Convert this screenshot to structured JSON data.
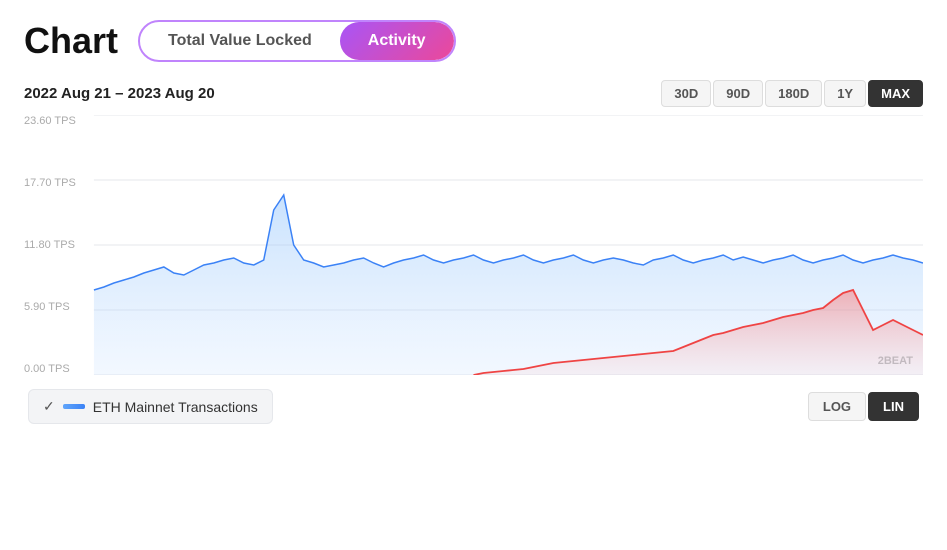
{
  "header": {
    "title": "Chart",
    "toggle": {
      "option1": "Total Value Locked",
      "option2": "Activity",
      "active": "Activity"
    }
  },
  "dateRange": {
    "label": "2022 Aug 21 – 2023 Aug 20"
  },
  "periodButtons": [
    {
      "label": "30D",
      "active": false
    },
    {
      "label": "90D",
      "active": false
    },
    {
      "label": "180D",
      "active": false
    },
    {
      "label": "1Y",
      "active": false
    },
    {
      "label": "MAX",
      "active": true
    }
  ],
  "yLabels": [
    {
      "value": "23.60 TPS"
    },
    {
      "value": "17.70 TPS"
    },
    {
      "value": "11.80 TPS"
    },
    {
      "value": "5.90 TPS"
    },
    {
      "value": "0.00 TPS"
    }
  ],
  "legend": {
    "checkmark": "✓",
    "colorLabel": "ETH Mainnet Transactions"
  },
  "scaleButtons": [
    {
      "label": "LOG",
      "active": false
    },
    {
      "label": "LIN",
      "active": true
    }
  ],
  "watermark": "2BEAT"
}
